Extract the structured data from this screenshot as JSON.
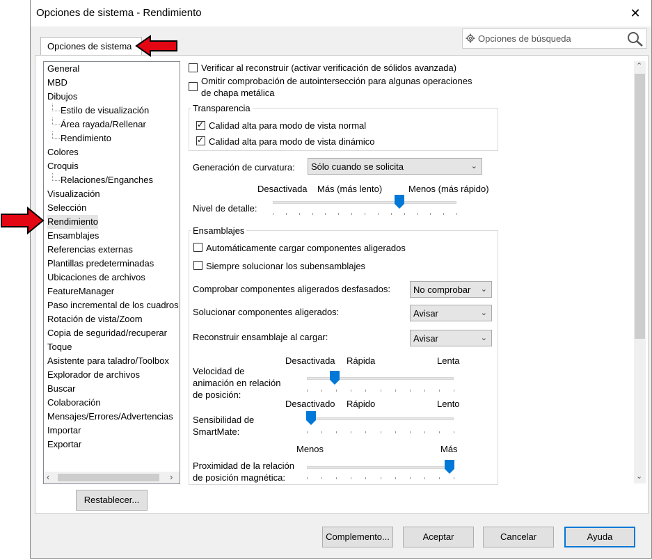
{
  "window": {
    "title": "Opciones de sistema - Rendimiento",
    "close_label": "✕"
  },
  "search": {
    "placeholder": "Opciones de búsqueda"
  },
  "tab": {
    "label": "Opciones de sistema"
  },
  "tree": {
    "items": [
      "General",
      "MBD",
      "Dibujos",
      "Estilo de visualización",
      "Área rayada/Rellenar",
      "Rendimiento",
      "Colores",
      "Croquis",
      "Relaciones/Enganches",
      "Visualización",
      "Selección",
      "Rendimiento",
      "Ensamblajes",
      "Referencias externas",
      "Plantillas predeterminadas",
      "Ubicaciones de archivos",
      "FeatureManager",
      "Paso incremental de los cuadros",
      "Rotación de vista/Zoom",
      "Copia de seguridad/recuperar",
      "Toque",
      "Asistente para taladro/Toolbox",
      "Explorador de archivos",
      "Buscar",
      "Colaboración",
      "Mensajes/Errores/Advertencias",
      "Importar",
      "Exportar"
    ]
  },
  "options": {
    "verify_rebuild": "Verificar al reconstruir (activar verificación de sólidos avanzada)",
    "skip_self_intersect_1": "Omitir comprobación de autointersección para algunas operaciones",
    "skip_self_intersect_2": "de chapa metálica",
    "transparency": {
      "title": "Transparencia",
      "normal": "Calidad alta para modo de vista normal",
      "dynamic": "Calidad alta para modo de vista dinámico"
    },
    "curvature": {
      "label": "Generación de curvatura:",
      "value": "Sólo cuando se solicita"
    },
    "detail": {
      "label": "Nivel de detalle:",
      "off": "Desactivada",
      "more": "Más (más lento)",
      "less": "Menos (más rápido)",
      "level": 0.69
    },
    "assemblies": {
      "title": "Ensamblajes",
      "auto_load": "Automáticamente cargar componentes aligerados",
      "always_resolve": "Siempre solucionar los subensamblajes",
      "check_outdated": {
        "label": "Comprobar componentes aligerados desfasados:",
        "value": "No comprobar"
      },
      "resolve_light": {
        "label": "Solucionar componentes aligerados:",
        "value": "Avisar"
      },
      "rebuild_load": {
        "label": "Reconstruir ensamblaje al cargar:",
        "value": "Avisar"
      },
      "anim_speed": {
        "label_1": "Velocidad de",
        "label_2": "animación en relación",
        "label_3": "de posición:",
        "off": "Desactivada",
        "fast": "Rápida",
        "slow": "Lenta",
        "level": 0.19
      },
      "smartmate": {
        "label_1": "Sensibilidad de",
        "label_2": "SmartMate:",
        "off": "Desactivado",
        "fast": "Rápido",
        "slow": "Lento",
        "level": 0.03
      },
      "magnetic": {
        "label_1": "Proximidad de la relación",
        "label_2": "de posición magnética:",
        "less": "Menos",
        "more": "Más",
        "level": 0.97
      }
    }
  },
  "buttons": {
    "reset": "Restablecer...",
    "addins": "Complemento...",
    "ok": "Aceptar",
    "cancel": "Cancelar",
    "help": "Ayuda"
  },
  "colors": {
    "accent": "#0078d7",
    "annotation_arrow": "#e30613"
  }
}
